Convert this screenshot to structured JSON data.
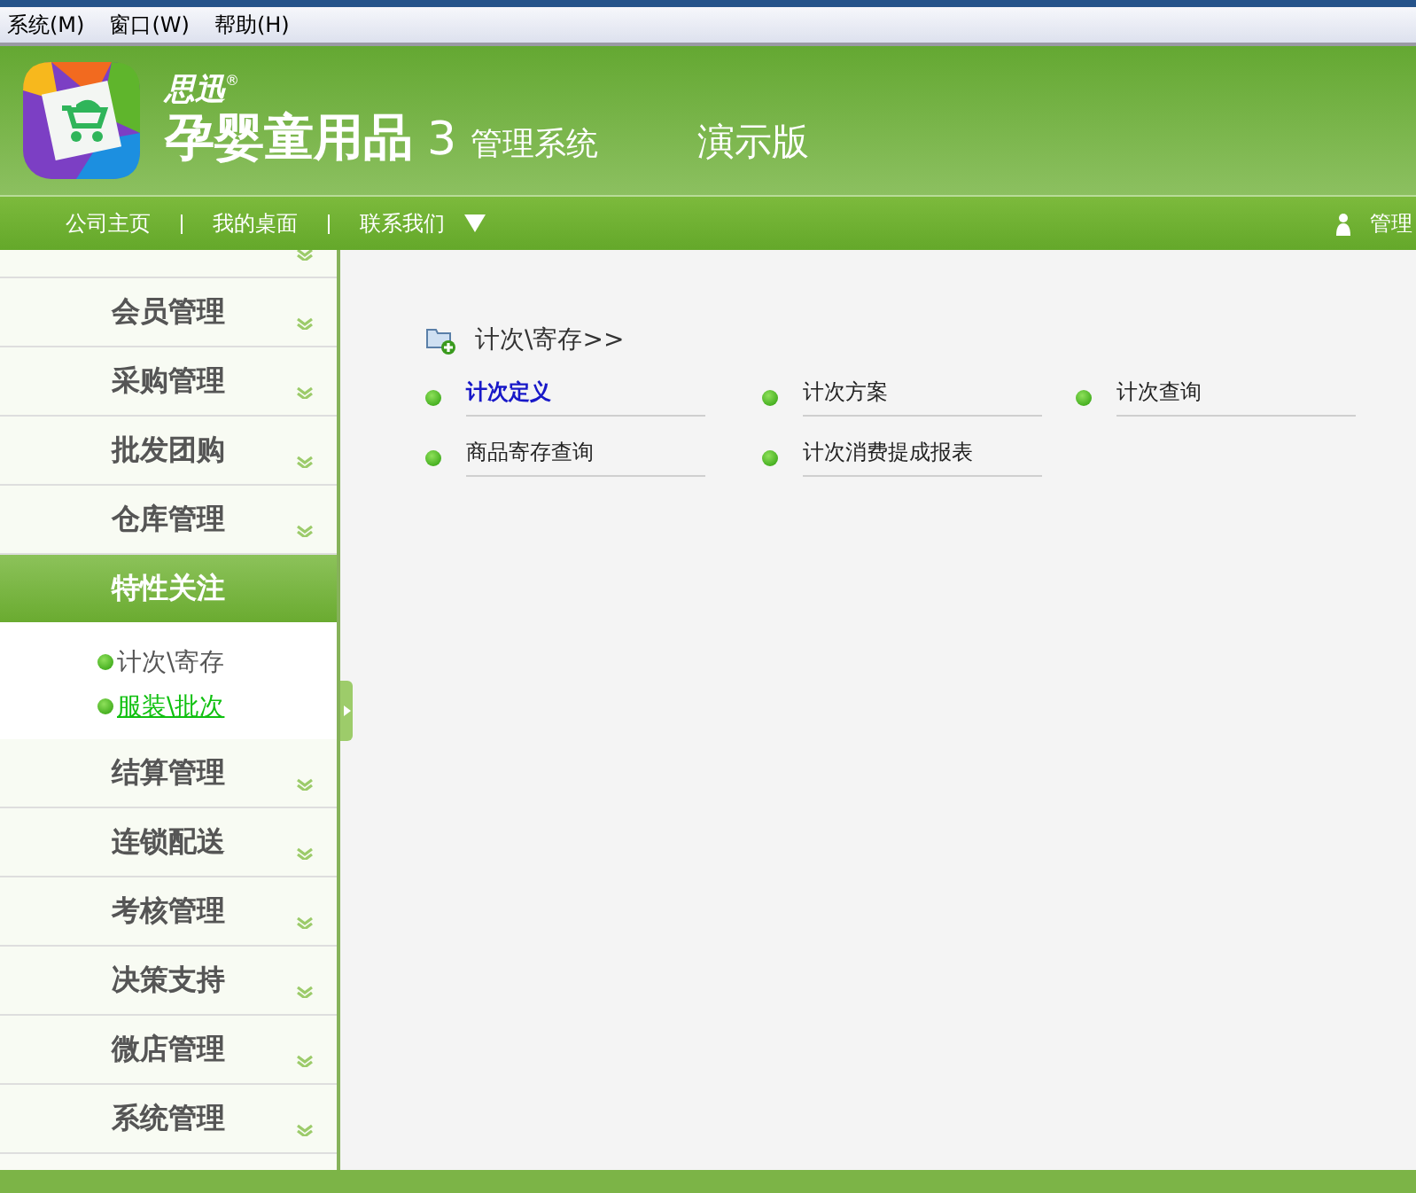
{
  "menu_bar": [
    "系统(M)",
    "窗口(W)",
    "帮助(H)"
  ],
  "header": {
    "brand": "思迅",
    "trademark": "®",
    "product": "孕婴童用品",
    "version": "3",
    "subtitle": "管理系统",
    "edition": "演示版"
  },
  "nav": [
    "公司主页",
    "我的桌面",
    "联系我们"
  ],
  "user": "管理",
  "sidebar": [
    {
      "expanded": false
    },
    {
      "label": "会员管理",
      "expanded": false
    },
    {
      "label": "采购管理",
      "expanded": false
    },
    {
      "label": "批发团购",
      "expanded": false
    },
    {
      "label": "仓库管理",
      "expanded": false
    },
    {
      "label": "特性关注",
      "expanded": true,
      "children": [
        {
          "label": "计次\\寄存",
          "selected": false
        },
        {
          "label": "服装\\批次",
          "selected": true
        }
      ]
    },
    {
      "label": "结算管理",
      "expanded": false
    },
    {
      "label": "连锁配送",
      "expanded": false
    },
    {
      "label": "考核管理",
      "expanded": false
    },
    {
      "label": "决策支持",
      "expanded": false
    },
    {
      "label": "微店管理",
      "expanded": false
    },
    {
      "label": "系统管理",
      "expanded": false
    }
  ],
  "content": {
    "title": "计次\\寄存>>",
    "links": [
      {
        "label": "计次定义",
        "selected": true
      },
      {
        "label": "计次方案",
        "selected": false
      },
      {
        "label": "计次查询",
        "selected": false
      },
      {
        "label": "商品寄存查询",
        "selected": false
      },
      {
        "label": "计次消费提成报表",
        "selected": false
      }
    ]
  }
}
